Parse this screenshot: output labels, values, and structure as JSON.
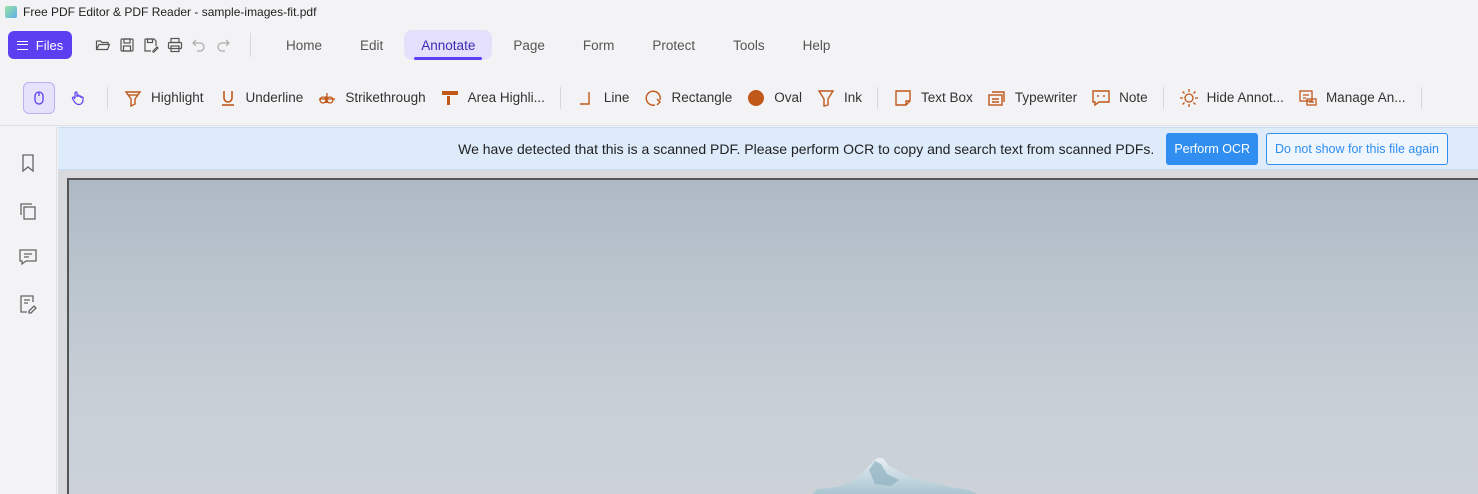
{
  "window": {
    "title": "Free PDF Editor & PDF Reader - sample-images-fit.pdf"
  },
  "menubar": {
    "files_label": "Files",
    "tabs": [
      {
        "label": "Home"
      },
      {
        "label": "Edit"
      },
      {
        "label": "Annotate",
        "active": true
      },
      {
        "label": "Page"
      },
      {
        "label": "Form"
      },
      {
        "label": "Protect"
      },
      {
        "label": "Tools"
      },
      {
        "label": "Help"
      }
    ]
  },
  "toolbar": {
    "tools": {
      "highlight": "Highlight",
      "underline": "Underline",
      "strikethrough": "Strikethrough",
      "area_highlight": "Area Highli...",
      "line": "Line",
      "rectangle": "Rectangle",
      "oval": "Oval",
      "ink": "Ink",
      "text_box": "Text Box",
      "typewriter": "Typewriter",
      "note": "Note",
      "hide_annotations": "Hide Annot...",
      "manage_annotations": "Manage An..."
    }
  },
  "ocr_banner": {
    "message": "We have detected that this is a scanned PDF.  Please perform OCR to copy and search text from scanned PDFs.",
    "perform_label": "Perform OCR",
    "dismiss_label": "Do not show for this file again"
  },
  "colors": {
    "accent": "#5b3ff0",
    "tool_orange": "#c0581a",
    "ocr_blue": "#2f8ef0"
  }
}
